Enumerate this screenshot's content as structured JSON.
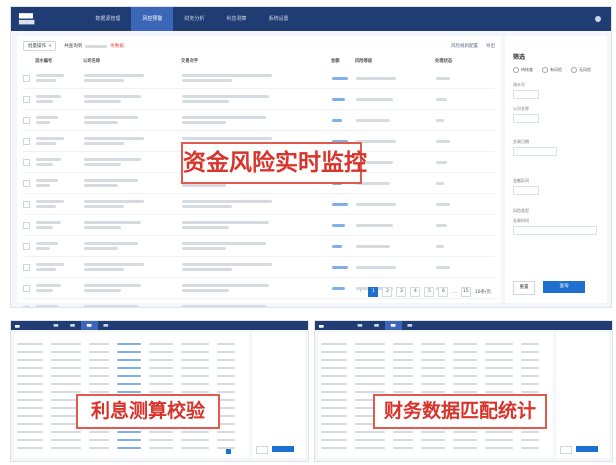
{
  "main": {
    "nav": [
      "数据源管理",
      "风控预警",
      "财务分析",
      "利息测算",
      "系统设置"
    ],
    "nav_active_index": 1,
    "toolbar": {
      "select": "批量操作",
      "summary_prefix": "共查询到",
      "summary_suffix": "条数据",
      "actions": [
        "风险规则配置",
        "导出"
      ]
    },
    "columns": [
      "流水编号",
      "公司名称",
      "交易对手",
      "金额",
      "风险等级",
      "处理状态"
    ],
    "pagination": {
      "pages": [
        "1",
        "2",
        "3",
        "4",
        "5",
        "6",
        "...",
        "15"
      ],
      "current": "1",
      "page_size": "10条/页"
    },
    "filter": {
      "title": "筛选",
      "radios": [
        "待核查",
        "有风险",
        "无风险"
      ],
      "fields": [
        "流水号",
        "公司名称",
        "交易日期",
        "金额区间",
        "风险类型",
        "交易时间"
      ],
      "reset": "重置",
      "query": "查询"
    }
  },
  "overlays": {
    "main_title": "资金风险实时监控",
    "sub1_title": "利息测算校验",
    "sub2_title": "财务数据匹配统计"
  },
  "colors": {
    "nav_bg": "#1f3d73",
    "accent": "#1f6fd1",
    "overlay_red": "#d9342b"
  }
}
